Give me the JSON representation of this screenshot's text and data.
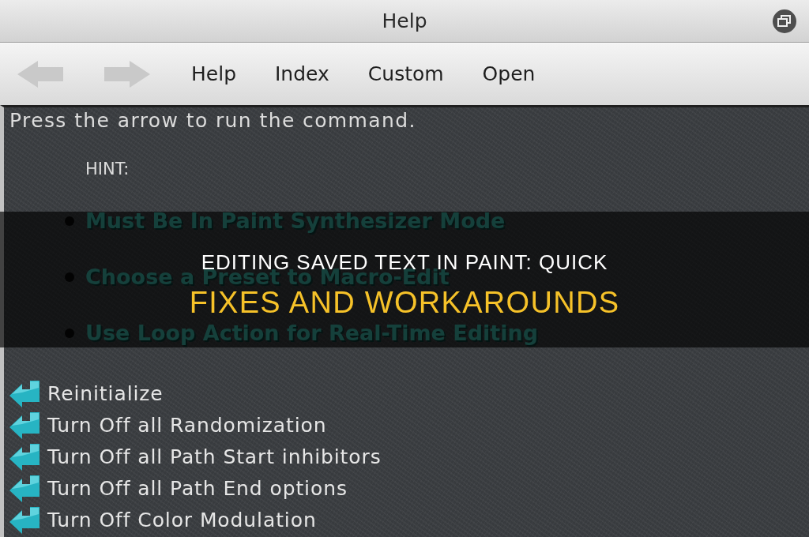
{
  "window": {
    "title": "Help"
  },
  "toolbar": {
    "nav": [
      {
        "kind": "back",
        "disabled": true
      },
      {
        "kind": "forward",
        "disabled": true
      }
    ],
    "links": [
      "Help",
      "Index",
      "Custom",
      "Open"
    ]
  },
  "content": {
    "intro": "Press the arrow to run the command.",
    "hint_label": "HINT:",
    "hints": [
      "Must Be In Paint Synthesizer Mode",
      "Choose a Preset to Macro-Edit",
      "Use Loop Action for Real-Time Editing"
    ],
    "commands": [
      "Reinitialize",
      "Turn Off all Randomization",
      "Turn Off all Path Start inhibitors",
      "Turn Off all Path End options",
      "Turn Off Color Modulation"
    ]
  },
  "banner": {
    "lines": [
      {
        "kind": "primary",
        "text": "EDITING SAVED TEXT IN PAINT: QUICK"
      },
      {
        "kind": "accent",
        "text": "FIXES AND WORKAROUNDS"
      }
    ]
  }
}
